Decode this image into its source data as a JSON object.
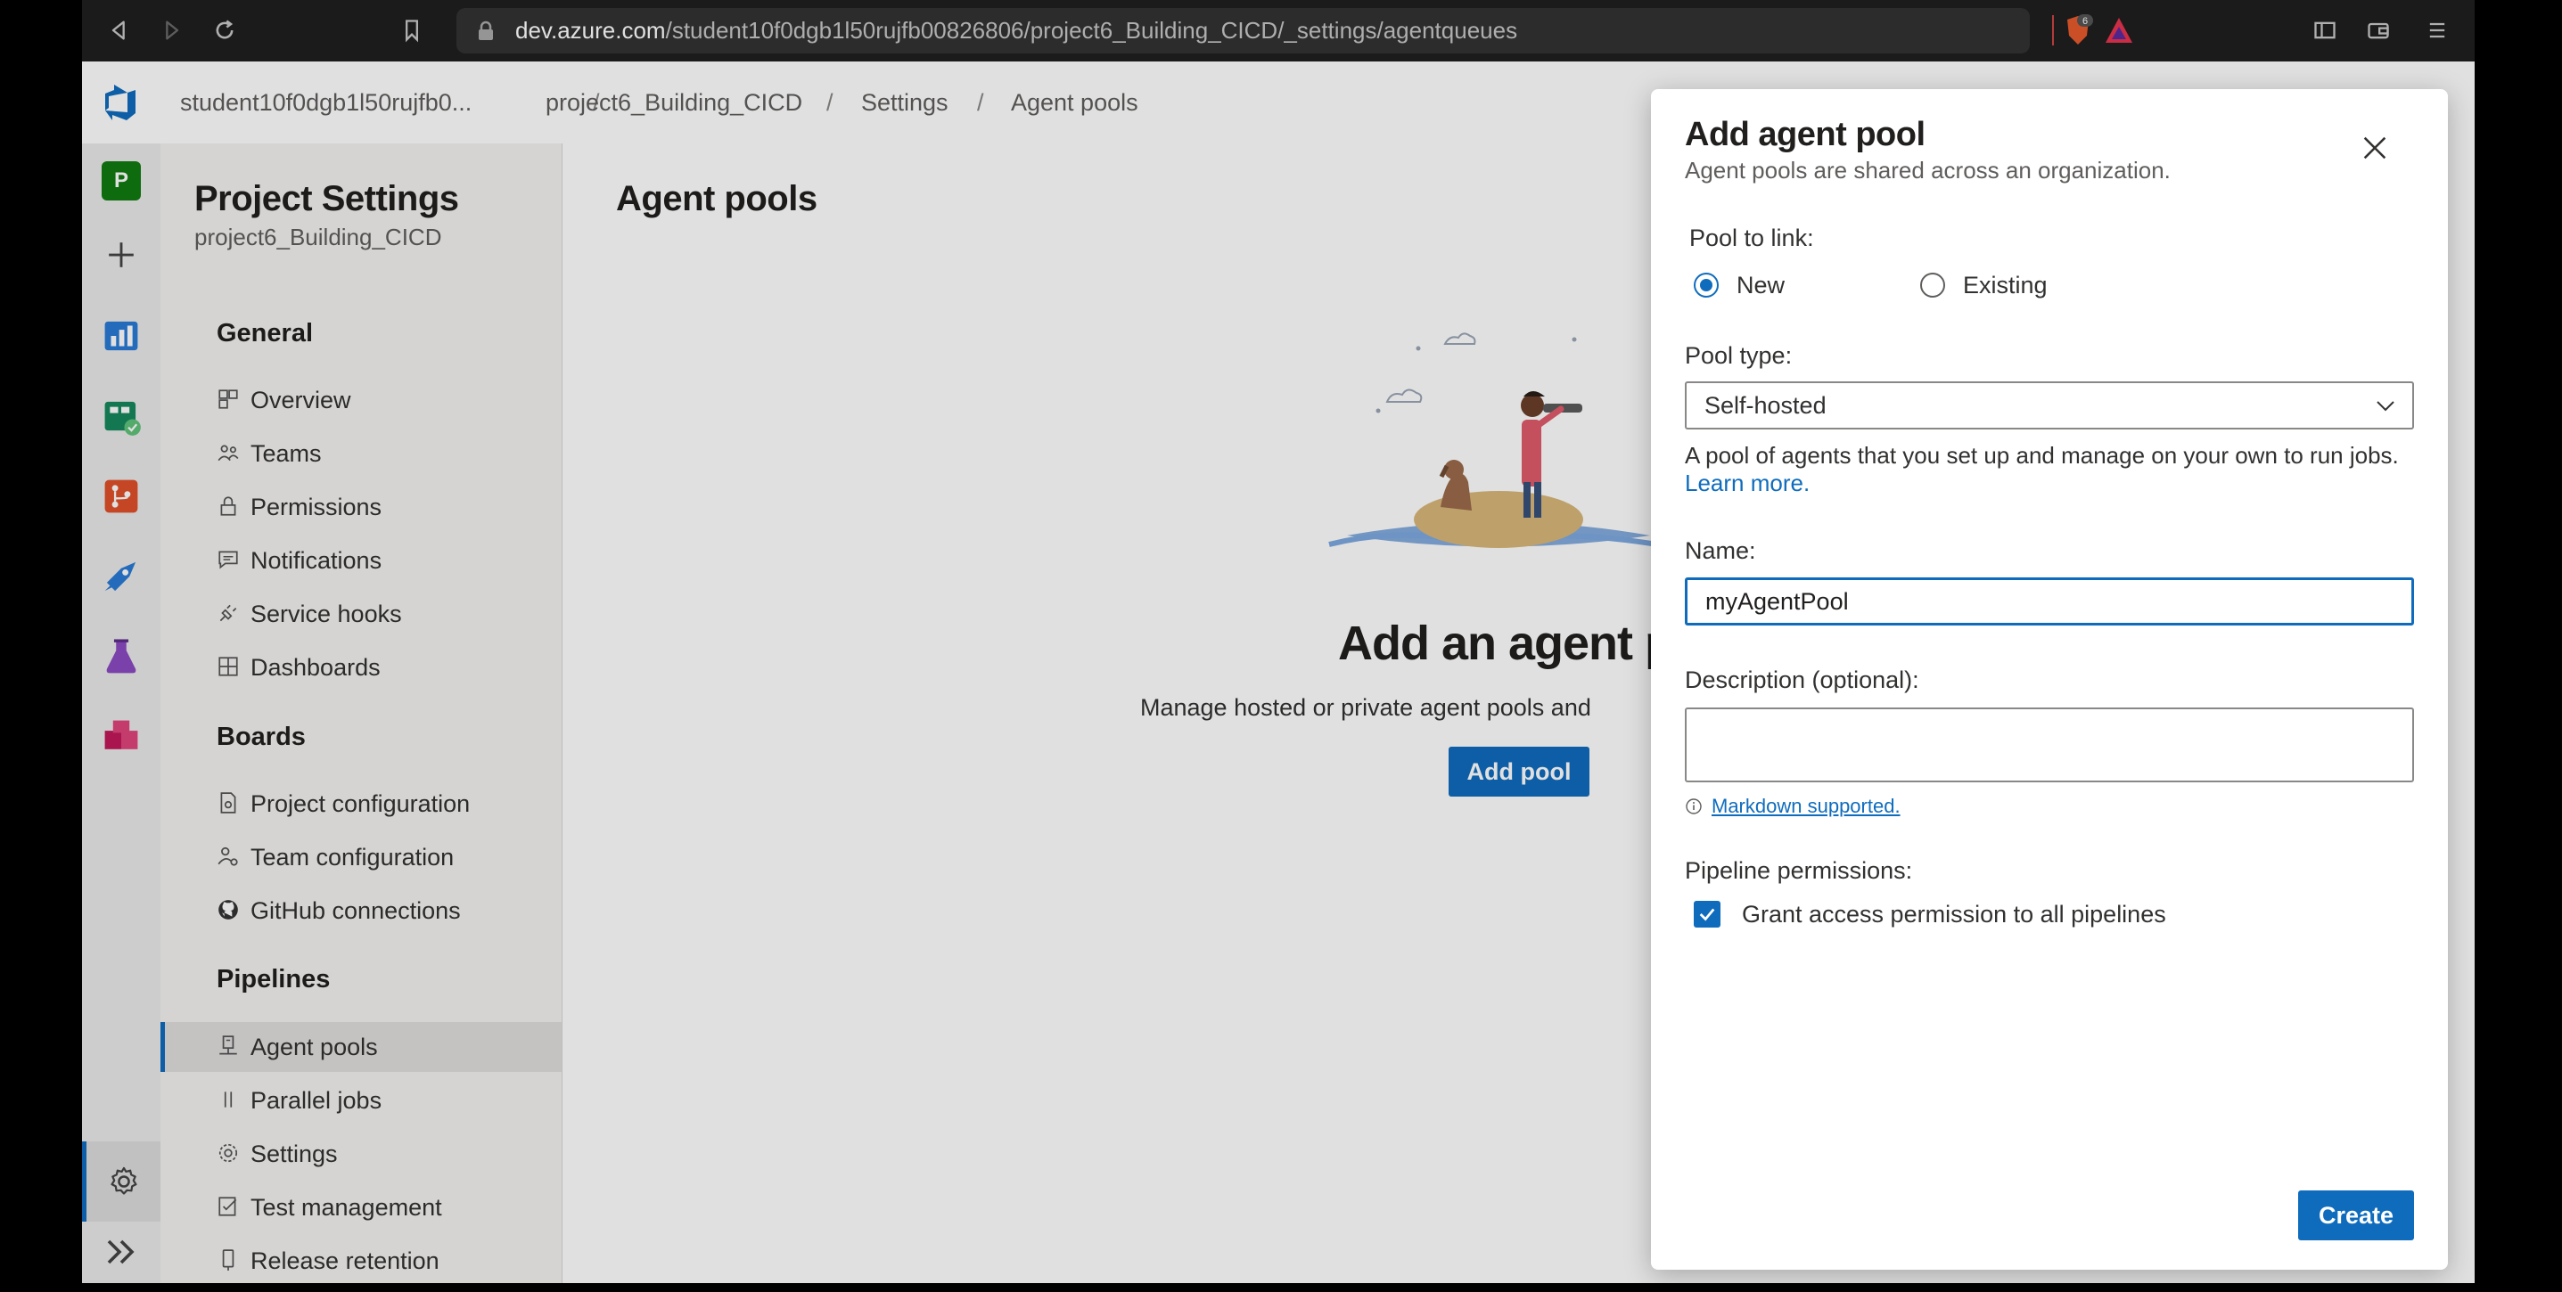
{
  "browser": {
    "url_host": "dev.azure.com",
    "url_path": "/student10f0dgb1l50rujfb00826806/project6_Building_CICD/_settings/agentqueues",
    "extension_badge": "6"
  },
  "breadcrumb": {
    "org": "student10f0dgb1l50rujfb0...",
    "project": "project6_Building_CICD",
    "settings": "Settings",
    "page": "Agent pools",
    "separator": "/"
  },
  "rail": {
    "project_initial": "P"
  },
  "settings_nav": {
    "title": "Project Settings",
    "subtitle": "project6_Building_CICD",
    "sections": {
      "general": "General",
      "boards": "Boards",
      "pipelines": "Pipelines"
    },
    "items": {
      "overview": "Overview",
      "teams": "Teams",
      "permissions": "Permissions",
      "notifications": "Notifications",
      "service_hooks": "Service hooks",
      "dashboards": "Dashboards",
      "project_configuration": "Project configuration",
      "team_configuration": "Team configuration",
      "github_connections": "GitHub connections",
      "agent_pools": "Agent pools",
      "parallel_jobs": "Parallel jobs",
      "settings": "Settings",
      "test_management": "Test management",
      "release_retention": "Release retention"
    }
  },
  "main": {
    "title": "Agent pools",
    "empty_title": "Add an agent po",
    "empty_description": "Manage hosted or private agent pools and",
    "add_pool_label": "Add pool"
  },
  "panel": {
    "title": "Add agent pool",
    "subtitle": "Agent pools are shared across an organization.",
    "pool_to_link_label": "Pool to link:",
    "radio_new": "New",
    "radio_existing": "Existing",
    "pool_type_label": "Pool type:",
    "pool_type_value": "Self-hosted",
    "pool_type_help": "A pool of agents that you set up and manage on your own to run jobs.",
    "learn_more": "Learn more.",
    "name_label": "Name:",
    "name_value": "myAgentPool",
    "description_label": "Description (optional):",
    "description_value": "",
    "markdown_link": "Markdown supported.",
    "pipeline_permissions_label": "Pipeline permissions:",
    "grant_access_label": "Grant access permission to all pipelines",
    "grant_access_checked": true,
    "create_label": "Create"
  },
  "colors": {
    "accent": "#0f6cbd",
    "project_avatar": "#107c10"
  }
}
